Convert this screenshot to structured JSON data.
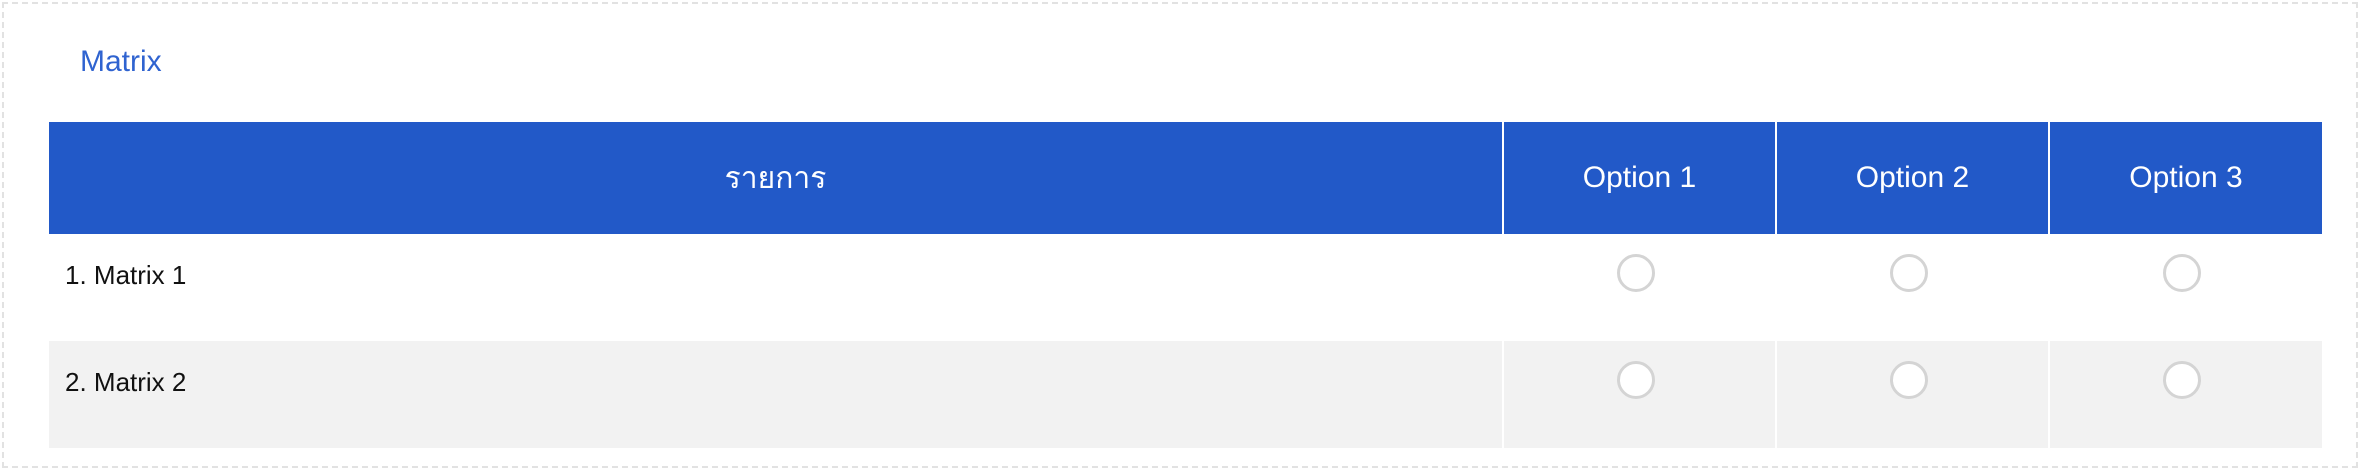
{
  "section": {
    "title": "Matrix"
  },
  "table": {
    "headers": [
      "รายการ",
      "Option 1",
      "Option 2",
      "Option 3"
    ],
    "rows": [
      {
        "label": "1. Matrix 1"
      },
      {
        "label": "2. Matrix 2"
      }
    ]
  },
  "colors": {
    "header_bg": "#2259c8",
    "title_text": "#2f63d0",
    "row_alt_bg": "#f2f2f2",
    "radio_border": "#d4d4d4"
  },
  "icons": {
    "radio": "radio-unchecked-icon"
  }
}
